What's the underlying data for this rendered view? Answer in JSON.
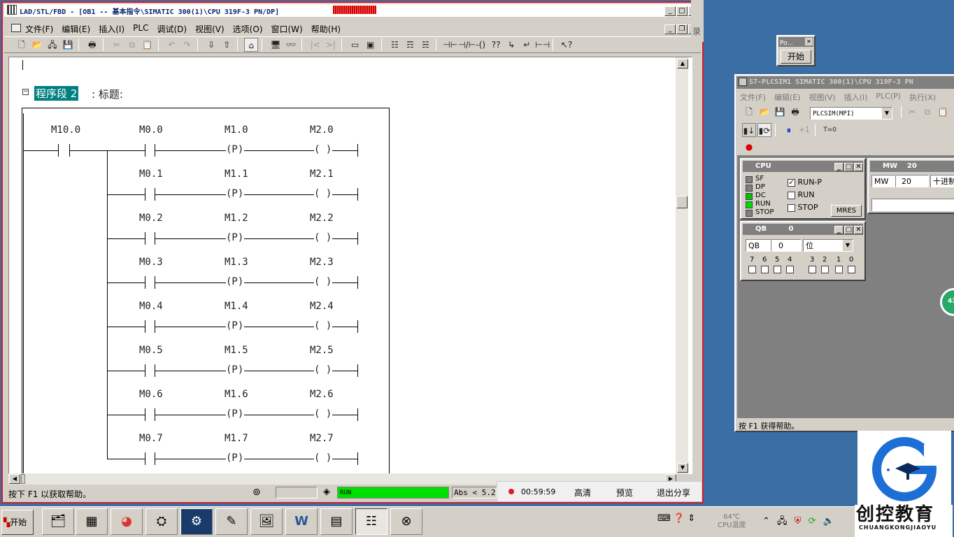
{
  "lad": {
    "title": "LAD/STL/FBD  - [OB1 -- 基本指令\\SIMATIC 300(1)\\CPU 319F-3 PN/DP]",
    "menu": [
      "文件(F)",
      "编辑(E)",
      "插入(I)",
      "PLC",
      "调试(D)",
      "视图(V)",
      "选项(O)",
      "窗口(W)",
      "帮助(H)"
    ],
    "network_label": "程序段 2",
    "network_suffix": ": 标题:",
    "main_contact": "M10.0",
    "rungs": [
      {
        "contact": "M0.0",
        "edge": "M1.0",
        "coil": "M2.0"
      },
      {
        "contact": "M0.1",
        "edge": "M1.1",
        "coil": "M2.1"
      },
      {
        "contact": "M0.2",
        "edge": "M1.2",
        "coil": "M2.2"
      },
      {
        "contact": "M0.3",
        "edge": "M1.3",
        "coil": "M2.3"
      },
      {
        "contact": "M0.4",
        "edge": "M1.4",
        "coil": "M2.4"
      },
      {
        "contact": "M0.5",
        "edge": "M1.5",
        "coil": "M2.5"
      },
      {
        "contact": "M0.6",
        "edge": "M1.6",
        "coil": "M2.6"
      },
      {
        "contact": "M0.7",
        "edge": "M1.7",
        "coil": "M2.7"
      }
    ],
    "edge_symbol": "(P)",
    "coil_symbol": "( )",
    "status_help": "按下 F1 以获取帮助。",
    "status_run": "RUN",
    "status_abs": "Abs < 5.2"
  },
  "recorder": {
    "time": "00:59:59",
    "quality": "高清",
    "preview": "预览",
    "exit": "退出分享"
  },
  "side_char": "录",
  "popup": {
    "title": "Po...",
    "button": "开始"
  },
  "plcsim": {
    "title": "S7-PLCSIM1   SIMATIC 300(1)\\CPU 319F-3 PN",
    "menu": [
      "文件(F)",
      "编辑(E)",
      "视图(V)",
      "插入(I)",
      "PLC(P)",
      "执行(X)"
    ],
    "connection": "PLCSIM(MPI)",
    "step_label": "+1",
    "timer_label": "T=0",
    "status_help": "按 F1 获得帮助。",
    "cpu": {
      "title": "CPU",
      "leds": [
        {
          "name": "SF",
          "color": "#808080"
        },
        {
          "name": "DP",
          "color": "#808080"
        },
        {
          "name": "DC",
          "color": "#00c000"
        },
        {
          "name": "RUN",
          "color": "#00e000"
        },
        {
          "name": "STOP",
          "color": "#808080"
        }
      ],
      "modes": [
        {
          "label": "RUN-P",
          "checked": true
        },
        {
          "label": "RUN",
          "checked": false
        },
        {
          "label": "STOP",
          "checked": false
        }
      ],
      "mres": "MRES"
    },
    "qb": {
      "title": "QB",
      "title_num": "0",
      "area": "QB",
      "address": "0",
      "format": "位",
      "bits": [
        "7",
        "6",
        "5",
        "4",
        "3",
        "2",
        "1",
        "0"
      ]
    },
    "mw": {
      "title": "MW",
      "title_num": "20",
      "area": "MW",
      "address": "20",
      "format": "十进制"
    }
  },
  "taskbar": {
    "start": "开始",
    "temp": "64℃",
    "temp_label": "CPU温度"
  },
  "watermark": {
    "name": "创控教育",
    "pinyin": "CHUANGKONGJIAOYU"
  },
  "badge": "43",
  "colors": {
    "titlebar": "#0a246a",
    "accent": "#008080",
    "desktop": "#3a6ea5",
    "run_green": "#00e000"
  }
}
